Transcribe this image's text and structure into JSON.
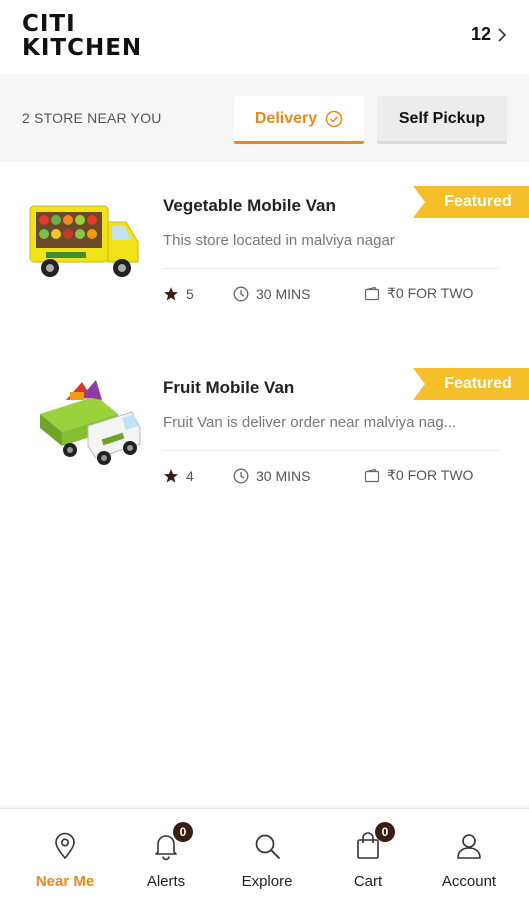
{
  "header": {
    "logo_line1": "CITI",
    "logo_line2": "KITCHEN",
    "right_text": "12"
  },
  "filter": {
    "store_count": "2 STORE NEAR YOU",
    "tabs": [
      {
        "label": "Delivery",
        "active": true
      },
      {
        "label": "Self Pickup",
        "active": false
      }
    ]
  },
  "stores": [
    {
      "name": "Vegetable Mobile Van",
      "description": "This store located in malviya nagar",
      "rating": "5",
      "time": "30 MINS",
      "price": "₹0 FOR TWO",
      "badge": "Featured",
      "image_icon": "vegetable-van-image"
    },
    {
      "name": "Fruit Mobile Van",
      "description": "Fruit Van is deliver order near malviya nag...",
      "rating": "4",
      "time": "30 MINS",
      "price": "₹0 FOR TWO",
      "badge": "Featured",
      "image_icon": "fruit-van-image"
    }
  ],
  "nav": {
    "items": [
      {
        "label": "Near Me",
        "icon": "location-pin-icon",
        "active": true
      },
      {
        "label": "Alerts",
        "icon": "bell-icon",
        "badge": "0"
      },
      {
        "label": "Explore",
        "icon": "search-icon"
      },
      {
        "label": "Cart",
        "icon": "shopping-bag-icon",
        "badge": "0"
      },
      {
        "label": "Account",
        "icon": "user-icon"
      }
    ]
  },
  "colors": {
    "accent": "#e8891d",
    "badge_yellow": "#f5bf2a",
    "badge_dark": "#3a1e14"
  }
}
